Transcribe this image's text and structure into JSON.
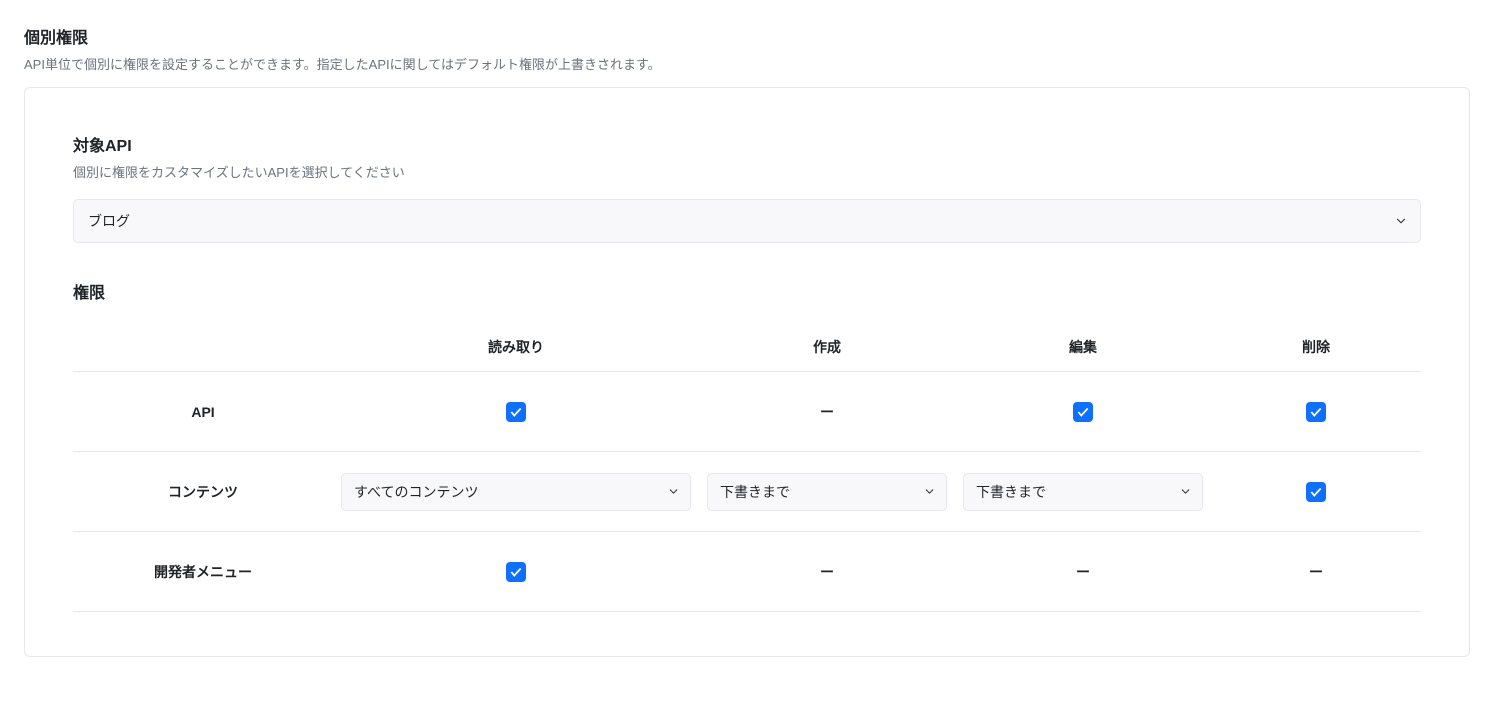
{
  "header": {
    "title": "個別権限",
    "desc": "API単位で個別に権限を設定することができます。指定したAPIに関してはデフォルト権限が上書きされます。"
  },
  "target_api": {
    "title": "対象API",
    "desc": "個別に権限をカスタマイズしたいAPIを選択してください",
    "selected": "ブログ"
  },
  "permissions": {
    "title": "権限",
    "columns": {
      "read": "読み取り",
      "create": "作成",
      "edit": "編集",
      "delete": "削除"
    },
    "rows": {
      "api": {
        "label": "API",
        "read_checked": true,
        "create_dash": "ー",
        "edit_checked": true,
        "delete_checked": true
      },
      "contents": {
        "label": "コンテンツ",
        "read_select": "すべてのコンテンツ",
        "create_select": "下書きまで",
        "edit_select": "下書きまで",
        "delete_checked": true
      },
      "devmenu": {
        "label": "開発者メニュー",
        "read_checked": true,
        "create_dash": "ー",
        "edit_dash": "ー",
        "delete_dash": "ー"
      }
    }
  }
}
